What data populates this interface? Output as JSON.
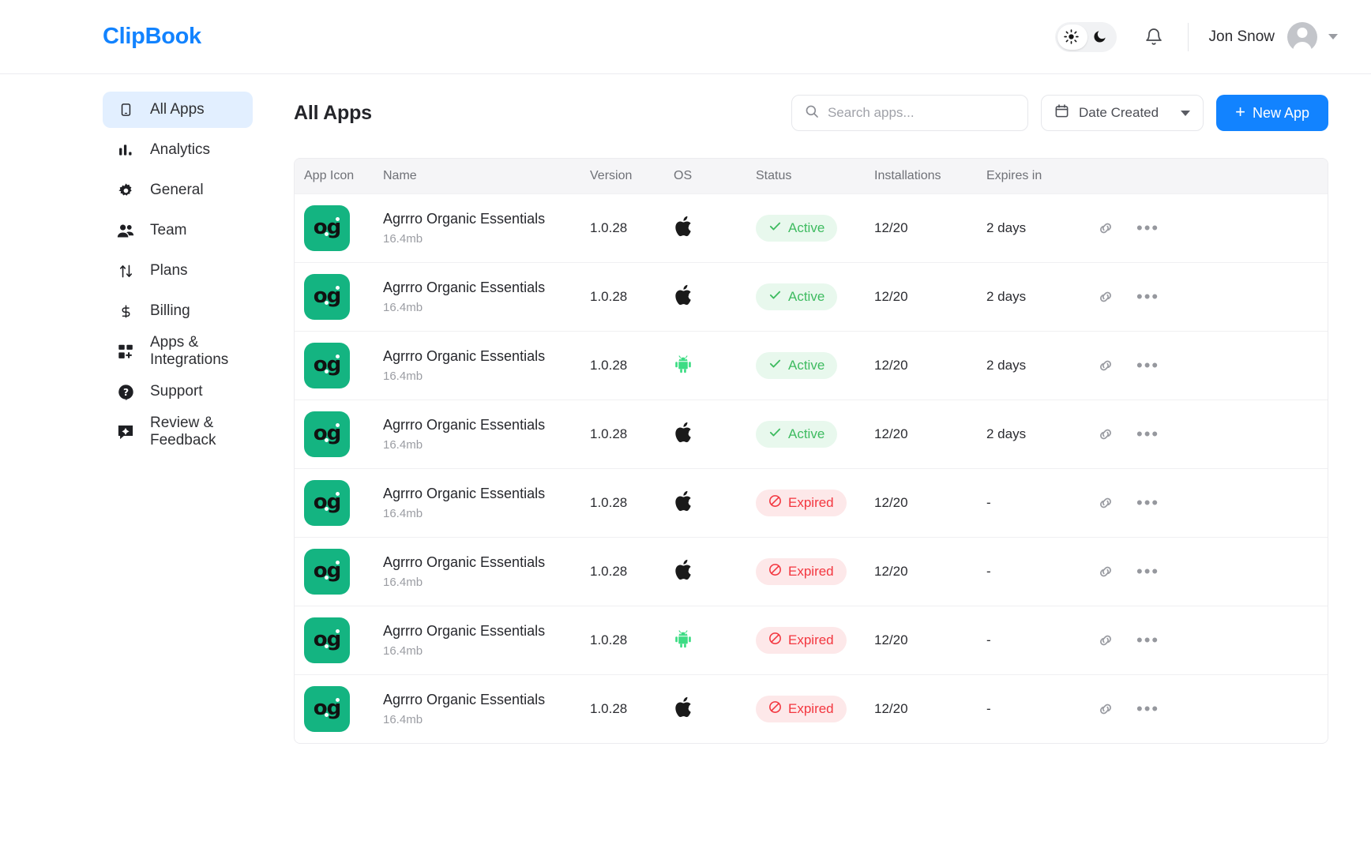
{
  "app": {
    "brand": "ClipBook"
  },
  "topbar": {
    "theme": {
      "light_icon": "sun-icon",
      "dark_icon": "moon-icon",
      "selected": "light"
    },
    "notifications_icon": "bell-icon",
    "user_name": "Jon Snow",
    "avatar_icon": "user-avatar",
    "dropdown_icon": "chevron-down-icon"
  },
  "sidebar": {
    "items": [
      {
        "label": "All Apps",
        "icon": "mobile-icon",
        "active": true
      },
      {
        "label": "Analytics",
        "icon": "bar-chart-icon",
        "active": false
      },
      {
        "label": "General",
        "icon": "gear-icon",
        "active": false
      },
      {
        "label": "Team",
        "icon": "people-icon",
        "active": false
      },
      {
        "label": "Plans",
        "icon": "arrows-updown-icon",
        "active": false
      },
      {
        "label": "Billing",
        "icon": "dollar-icon",
        "active": false
      },
      {
        "label": "Apps & Integrations",
        "icon": "grid-plus-icon",
        "active": false
      },
      {
        "label": "Support",
        "icon": "help-icon",
        "active": false
      },
      {
        "label": "Review & Feedback",
        "icon": "feedback-icon",
        "active": false
      }
    ]
  },
  "main": {
    "page_title": "All Apps",
    "search": {
      "placeholder": "Search apps...",
      "value": "",
      "icon": "search-icon"
    },
    "date_filter": {
      "label": "Date Created",
      "icon": "calendar-icon",
      "caret": "chevron-down-icon"
    },
    "new_app_button": {
      "label": "New App",
      "icon": "plus-icon",
      "color": "#1283ff"
    }
  },
  "table": {
    "columns": [
      "App Icon",
      "Name",
      "Version",
      "OS",
      "Status",
      "Installations",
      "Expires in"
    ],
    "row_actions": {
      "link_icon": "link-icon",
      "more_icon": "more-horizontal-icon"
    },
    "rows": [
      {
        "app_icon": "og-logo",
        "name": "Agrrro Organic Essentials",
        "size": "16.4mb",
        "version": "1.0.28",
        "os": "apple",
        "status": "Active",
        "installations": "12/20",
        "expires_in": "2 days"
      },
      {
        "app_icon": "og-logo",
        "name": "Agrrro Organic Essentials",
        "size": "16.4mb",
        "version": "1.0.28",
        "os": "apple",
        "status": "Active",
        "installations": "12/20",
        "expires_in": "2 days"
      },
      {
        "app_icon": "og-logo",
        "name": "Agrrro Organic Essentials",
        "size": "16.4mb",
        "version": "1.0.28",
        "os": "android",
        "status": "Active",
        "installations": "12/20",
        "expires_in": "2 days"
      },
      {
        "app_icon": "og-logo",
        "name": "Agrrro Organic Essentials",
        "size": "16.4mb",
        "version": "1.0.28",
        "os": "apple",
        "status": "Active",
        "installations": "12/20",
        "expires_in": "2 days"
      },
      {
        "app_icon": "og-logo",
        "name": "Agrrro Organic Essentials",
        "size": "16.4mb",
        "version": "1.0.28",
        "os": "apple",
        "status": "Expired",
        "installations": "12/20",
        "expires_in": "-"
      },
      {
        "app_icon": "og-logo",
        "name": "Agrrro Organic Essentials",
        "size": "16.4mb",
        "version": "1.0.28",
        "os": "apple",
        "status": "Expired",
        "installations": "12/20",
        "expires_in": "-"
      },
      {
        "app_icon": "og-logo",
        "name": "Agrrro Organic Essentials",
        "size": "16.4mb",
        "version": "1.0.28",
        "os": "android",
        "status": "Expired",
        "installations": "12/20",
        "expires_in": "-"
      },
      {
        "app_icon": "og-logo",
        "name": "Agrrro Organic Essentials",
        "size": "16.4mb",
        "version": "1.0.28",
        "os": "apple",
        "status": "Expired",
        "installations": "12/20",
        "expires_in": "-"
      }
    ]
  },
  "colors": {
    "brand": "#1283ff",
    "app_icon_bg": "#14b481",
    "active_text": "#3ebb60",
    "active_bg": "#e8f8ed",
    "expired_text": "#f3363f",
    "expired_bg": "#fde8e9",
    "android_green": "#3ddc84",
    "sidebar_active_bg": "#e2efff"
  }
}
